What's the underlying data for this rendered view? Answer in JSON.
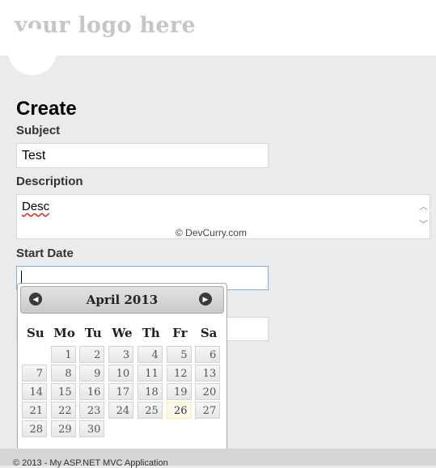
{
  "header": {
    "logo": "your logo here"
  },
  "form": {
    "title": "Create",
    "subject": {
      "label": "Subject",
      "value": "Test"
    },
    "description": {
      "label": "Description",
      "value": "Desc"
    },
    "start_date": {
      "label": "Start Date",
      "value": ""
    }
  },
  "watermark": "© DevCurry.com",
  "datepicker": {
    "month_year": "April 2013",
    "weekdays": [
      "Su",
      "Mo",
      "Tu",
      "We",
      "Th",
      "Fr",
      "Sa"
    ],
    "weeks": [
      [
        "",
        "1",
        "2",
        "3",
        "4",
        "5",
        "6"
      ],
      [
        "7",
        "8",
        "9",
        "10",
        "11",
        "12",
        "13"
      ],
      [
        "14",
        "15",
        "16",
        "17",
        "18",
        "19",
        "20"
      ],
      [
        "21",
        "22",
        "23",
        "24",
        "25",
        "26",
        "27"
      ],
      [
        "28",
        "29",
        "30",
        "",
        "",
        "",
        ""
      ]
    ],
    "today": "26"
  },
  "footer": {
    "text": "© 2013 - My ASP.NET MVC Application"
  }
}
